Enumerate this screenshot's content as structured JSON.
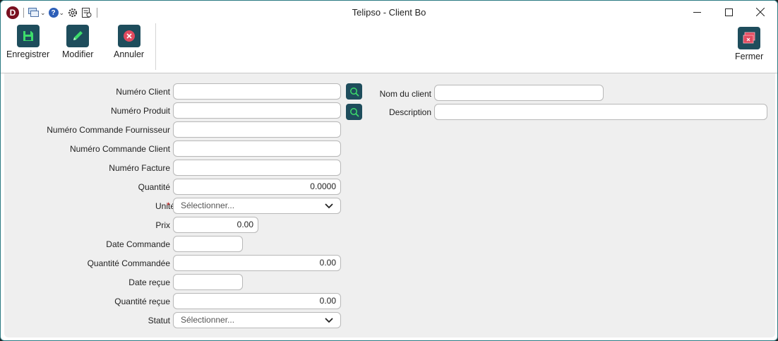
{
  "window": {
    "title": "Telipso - Client Bo"
  },
  "titlebar_icons": {
    "app_logo": "D",
    "quick_access": [
      "windows-icon",
      "help-icon",
      "gear-icon",
      "document-icon"
    ],
    "help_glyph": "?"
  },
  "toolbar": {
    "save_label": "Enregistrer",
    "modify_label": "Modifier",
    "cancel_label": "Annuler",
    "close_label": "Fermer"
  },
  "colors": {
    "accent": "#1e4d5c",
    "save_icon": "#3ddc6b",
    "modify_icon": "#3ddc6b",
    "cancel_icon": "#e04a5f",
    "close_icon": "#e04a5f",
    "required": "#d02020"
  },
  "form": {
    "numero_client": {
      "label": "Numéro Client",
      "value": ""
    },
    "numero_produit": {
      "label": "Numéro Produit",
      "value": ""
    },
    "numero_commande_fournisseur": {
      "label": "Numéro Commande Fournisseur",
      "value": ""
    },
    "numero_commande_client": {
      "label": "Numéro Commande Client",
      "value": ""
    },
    "numero_facture": {
      "label": "Numéro Facture",
      "value": ""
    },
    "quantite": {
      "label": "Quantité",
      "value": "0.0000"
    },
    "unite": {
      "label": "Unité",
      "required_mark": "*",
      "value": "Sélectionner..."
    },
    "prix": {
      "label": "Prix",
      "value": "0.00"
    },
    "date_commande": {
      "label": "Date Commande",
      "value": ""
    },
    "quantite_commandee": {
      "label": "Quantité Commandée",
      "value": "0.00"
    },
    "date_recue": {
      "label": "Date reçue",
      "value": ""
    },
    "quantite_recue": {
      "label": "Quantité reçue",
      "value": "0.00"
    },
    "statut": {
      "label": "Statut",
      "value": "Sélectionner..."
    },
    "nom_du_client": {
      "label": "Nom du client",
      "value": ""
    },
    "description": {
      "label": "Description",
      "value": ""
    }
  }
}
